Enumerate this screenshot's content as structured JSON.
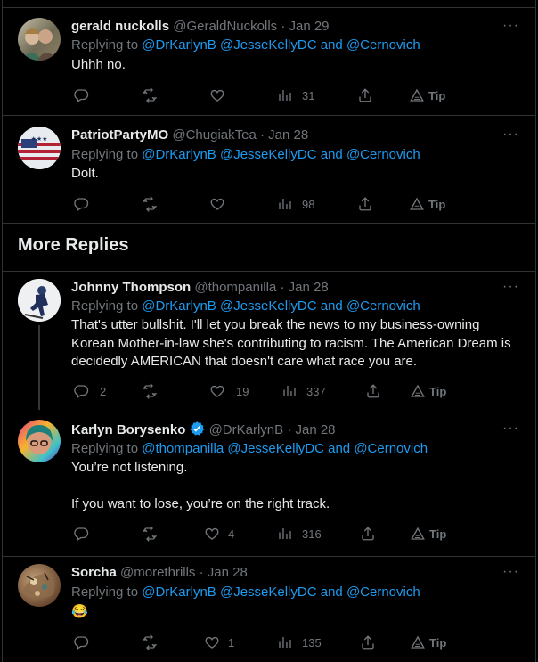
{
  "section_title": "More Replies",
  "tweets": [
    {
      "name": "gerald nuckolls",
      "handle": "@GeraldNuckolls",
      "date": "· Jan 29",
      "replying_prefix": "Replying to ",
      "mentions": [
        "@DrKarlynB",
        "@JesseKellyDC",
        "and",
        "@Cernovich"
      ],
      "text": "Uhhh no.",
      "stats": {
        "replies": "",
        "retweets": "",
        "likes": "",
        "views": "31",
        "tip": "Tip"
      }
    },
    {
      "name": "PatriotPartyMO",
      "handle": "@ChugiakTea",
      "date": "· Jan 28",
      "replying_prefix": "Replying to ",
      "mentions": [
        "@DrKarlynB",
        "@JesseKellyDC",
        "and",
        "@Cernovich"
      ],
      "text": "Dolt.",
      "stats": {
        "replies": "",
        "retweets": "",
        "likes": "",
        "views": "98",
        "tip": "Tip"
      }
    },
    {
      "name": "Johnny Thompson",
      "handle": "@thompanilla",
      "date": "· Jan 28",
      "replying_prefix": "Replying to ",
      "mentions": [
        "@DrKarlynB",
        "@JesseKellyDC",
        "and",
        "@Cernovich"
      ],
      "text": "That's utter bullshit.  I'll let you break the news to my business-owning Korean Mother-in-law she's contributing to racism.  The American Dream is decidedly AMERICAN that doesn't care what race you are.",
      "stats": {
        "replies": "2",
        "retweets": "",
        "likes": "19",
        "views": "337",
        "tip": "Tip"
      }
    },
    {
      "name": "Karlyn Borysenko",
      "handle": "@DrKarlynB",
      "date": "· Jan 28",
      "replying_prefix": "Replying to ",
      "mentions": [
        "@thompanilla",
        "@JesseKellyDC",
        "and",
        "@Cernovich"
      ],
      "text_line1": "You’re not listening.",
      "text_line2": "If you want to lose, you’re on the right track.",
      "stats": {
        "replies": "",
        "retweets": "",
        "likes": "4",
        "views": "316",
        "tip": "Tip"
      }
    },
    {
      "name": "Sorcha",
      "handle": "@morethrills",
      "date": "· Jan 28",
      "replying_prefix": "Replying to ",
      "mentions": [
        "@DrKarlynB",
        "@JesseKellyDC",
        "and",
        "@Cernovich"
      ],
      "text": "😂",
      "stats": {
        "replies": "",
        "retweets": "",
        "likes": "1",
        "views": "135",
        "tip": "Tip"
      }
    }
  ],
  "more_glyph": "···",
  "colors": {
    "background": "#000000",
    "text": "#e7e9ea",
    "muted": "#71767b",
    "link": "#1d9bf0",
    "border": "#2f3336",
    "verified": "#1d9bf0"
  },
  "icons": [
    "reply-icon",
    "retweet-icon",
    "like-icon",
    "views-icon",
    "share-icon",
    "tip-icon",
    "more-icon",
    "verified-icon"
  ]
}
